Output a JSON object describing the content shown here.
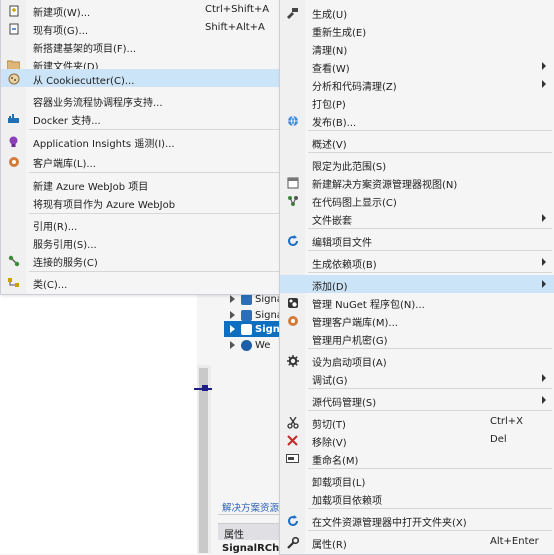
{
  "left_menu": {
    "items": [
      {
        "label": "新建项(W)...",
        "shortcut": "Ctrl+Shift+A",
        "icon": "new-item-icon"
      },
      {
        "label": "现有项(G)...",
        "shortcut": "Shift+Alt+A",
        "icon": "existing-item-icon"
      },
      {
        "label": "新搭建基架的项目(F)...",
        "shortcut": "",
        "icon": ""
      },
      {
        "label": "新建文件夹(D)",
        "shortcut": "",
        "icon": "folder-icon"
      },
      {
        "label": "从 Cookiecutter(C)...",
        "shortcut": "",
        "icon": "cookiecutter-icon"
      },
      {
        "label": "容器业务流程协调程序支持...",
        "shortcut": "",
        "icon": ""
      },
      {
        "label": "Docker 支持...",
        "shortcut": "",
        "icon": "docker-icon"
      },
      {
        "label": "Application Insights 遥测(I)...",
        "shortcut": "",
        "icon": "lightbulb-icon"
      },
      {
        "label": "客户端库(L)...",
        "shortcut": "",
        "icon": "client-library-icon"
      },
      {
        "label": "新建 Azure WebJob 项目",
        "shortcut": "",
        "icon": ""
      },
      {
        "label": "将现有项目作为 Azure WebJob",
        "shortcut": "",
        "icon": ""
      },
      {
        "label": "引用(R)...",
        "shortcut": "",
        "icon": ""
      },
      {
        "label": "服务引用(S)...",
        "shortcut": "",
        "icon": ""
      },
      {
        "label": "连接的服务(C)",
        "shortcut": "",
        "icon": "connected-service-icon"
      },
      {
        "label": "类(C)...",
        "shortcut": "",
        "icon": "class-icon"
      }
    ]
  },
  "right_menu": {
    "items": [
      {
        "label": "生成(U)",
        "shortcut": "",
        "icon": "build-icon"
      },
      {
        "label": "重新生成(E)",
        "shortcut": "",
        "icon": ""
      },
      {
        "label": "清理(N)",
        "shortcut": "",
        "icon": ""
      },
      {
        "label": "查看(W)",
        "shortcut": "",
        "icon": ""
      },
      {
        "label": "分析和代码清理(Z)",
        "shortcut": "",
        "icon": ""
      },
      {
        "label": "打包(P)",
        "shortcut": "",
        "icon": ""
      },
      {
        "label": "发布(B)...",
        "shortcut": "",
        "icon": "publish-globe-icon"
      },
      {
        "label": "概述(V)",
        "shortcut": "",
        "icon": ""
      },
      {
        "label": "限定为此范围(S)",
        "shortcut": "",
        "icon": ""
      },
      {
        "label": "新建解决方案资源管理器视图(N)",
        "shortcut": "",
        "icon": "new-view-icon"
      },
      {
        "label": "在代码图上显示(C)",
        "shortcut": "",
        "icon": "code-map-icon"
      },
      {
        "label": "文件嵌套",
        "shortcut": "",
        "icon": ""
      },
      {
        "label": "编辑项目文件",
        "shortcut": "",
        "icon": "edit-refresh-icon"
      },
      {
        "label": "生成依赖项(B)",
        "shortcut": "",
        "icon": ""
      },
      {
        "label": "添加(D)",
        "shortcut": "",
        "icon": ""
      },
      {
        "label": "管理 NuGet 程序包(N)...",
        "shortcut": "",
        "icon": "nuget-icon"
      },
      {
        "label": "管理客户端库(M)...",
        "shortcut": "",
        "icon": "client-library-icon"
      },
      {
        "label": "管理用户机密(G)",
        "shortcut": "",
        "icon": ""
      },
      {
        "label": "设为启动项目(A)",
        "shortcut": "",
        "icon": "gear-icon"
      },
      {
        "label": "调试(G)",
        "shortcut": "",
        "icon": ""
      },
      {
        "label": "源代码管理(S)",
        "shortcut": "",
        "icon": ""
      },
      {
        "label": "剪切(T)",
        "shortcut": "Ctrl+X",
        "icon": "scissors-icon"
      },
      {
        "label": "移除(V)",
        "shortcut": "Del",
        "icon": "remove-x-icon"
      },
      {
        "label": "重命名(M)",
        "shortcut": "",
        "icon": "rename-icon"
      },
      {
        "label": "卸载项目(L)",
        "shortcut": "",
        "icon": ""
      },
      {
        "label": "加载项目依赖项",
        "shortcut": "",
        "icon": ""
      },
      {
        "label": "在文件资源管理器中打开文件夹(X)",
        "shortcut": "",
        "icon": "open-folder-refresh-icon"
      },
      {
        "label": "属性(R)",
        "shortcut": "Alt+Enter",
        "icon": "wrench-icon"
      }
    ]
  },
  "solution_explorer": {
    "items": [
      {
        "label": "Signa"
      },
      {
        "label": "Signa"
      },
      {
        "label": "Signa"
      },
      {
        "label": "We"
      }
    ],
    "tab_label": "解决方案资源",
    "properties_title": "属性",
    "properties_object": "SignalRCha"
  },
  "colors": {
    "highlight": "#cce4f7",
    "selection": "#0e6fc0",
    "link_blue": "#2a62b4"
  }
}
